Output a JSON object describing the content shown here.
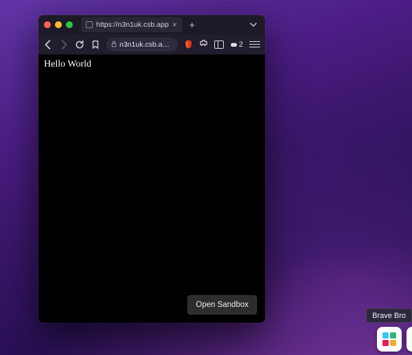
{
  "browser": {
    "tab": {
      "title": "https://n3n1uk.csb.app"
    },
    "address": {
      "url_display": "n3n1uk.csb.a…"
    },
    "shields": {
      "count": "2"
    }
  },
  "page": {
    "body_text": "Hello World",
    "open_sandbox_label": "Open Sandbox"
  },
  "dock": {
    "tooltip": "Brave Bro"
  }
}
